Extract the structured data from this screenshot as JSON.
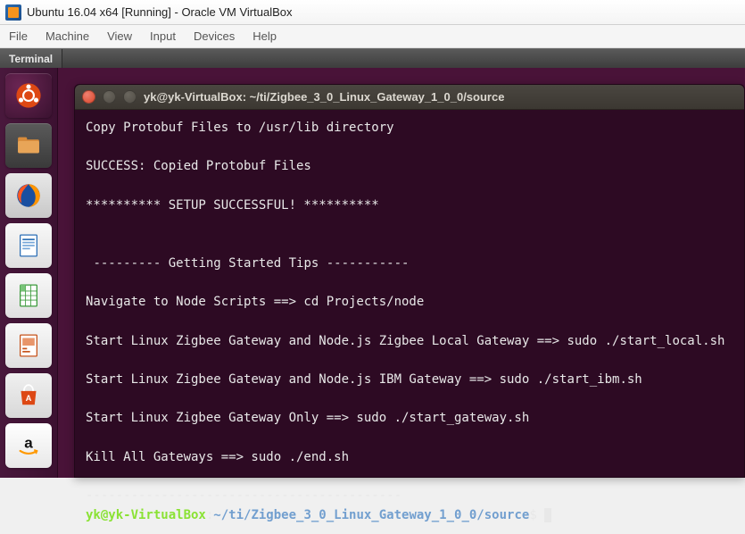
{
  "virtualbox": {
    "title": "Ubuntu 16.04 x64 [Running] - Oracle VM VirtualBox",
    "menu": {
      "file": "File",
      "machine": "Machine",
      "view": "View",
      "input": "Input",
      "devices": "Devices",
      "help": "Help"
    }
  },
  "ubuntu": {
    "tab": "Terminal"
  },
  "launcher": {
    "items": [
      "ubuntu",
      "files",
      "firefox",
      "writer",
      "calc",
      "impress",
      "software",
      "amazon"
    ]
  },
  "terminal": {
    "title": "yk@yk-VirtualBox: ~/ti/Zigbee_3_0_Linux_Gateway_1_0_0/source",
    "lines": {
      "copy": "Copy Protobuf Files to /usr/lib directory",
      "success": "SUCCESS: Copied Protobuf Files",
      "setup": "********** SETUP SUCCESSFUL! **********",
      "tips_hdr": " --------- Getting Started Tips -----------",
      "navigate": "Navigate to Node Scripts ==> cd Projects/node",
      "start_local": "Start Linux Zigbee Gateway and Node.js Zigbee Local Gateway ==> sudo ./start_local.sh",
      "start_ibm": "Start Linux Zigbee Gateway and Node.js IBM Gateway ==> sudo ./start_ibm.sh",
      "start_only": "Start Linux Zigbee Gateway Only ==> sudo ./start_gateway.sh",
      "kill": "Kill All Gateways ==> sudo ./end.sh",
      "dashes": "------------------------------------------"
    },
    "prompt": {
      "user_host": "yk@yk-VirtualBox",
      "colon": ":",
      "path": "~/ti/Zigbee_3_0_Linux_Gateway_1_0_0/source",
      "dollar": "$ "
    }
  }
}
